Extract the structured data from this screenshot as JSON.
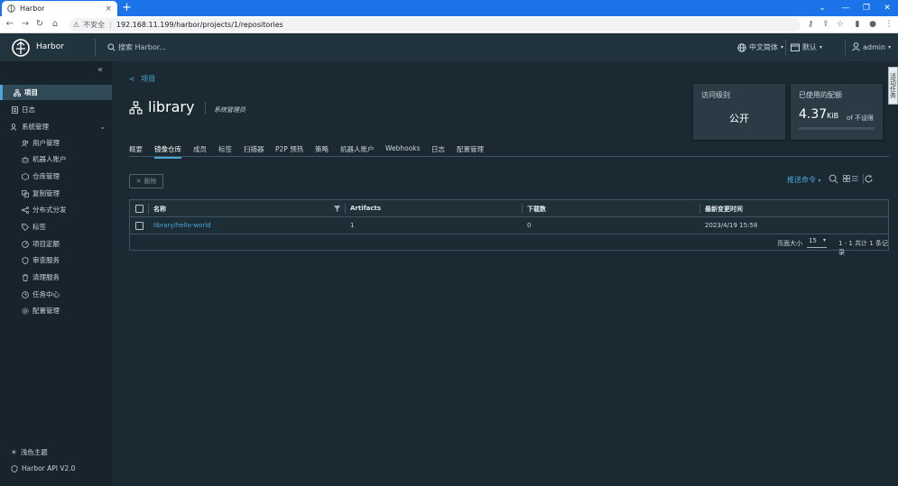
{
  "browser": {
    "tab_title": "Harbor",
    "tab_close": "×",
    "new_tab": "+",
    "insecure_label": "不安全",
    "address": "192.168.11.199/harbor/projects/1/repositories"
  },
  "header": {
    "brand": "Harbor",
    "search_placeholder": "搜索 Harbor...",
    "language": "中文简体",
    "datetime_format": "默认",
    "user": "admin"
  },
  "sidebar": {
    "items": [
      {
        "label": "项目"
      },
      {
        "label": "日志"
      },
      {
        "label": "系统管理"
      },
      {
        "label": "用户管理"
      },
      {
        "label": "机器人账户"
      },
      {
        "label": "仓库管理"
      },
      {
        "label": "复制管理"
      },
      {
        "label": "分布式分发"
      },
      {
        "label": "标签"
      },
      {
        "label": "项目定额"
      },
      {
        "label": "审查服务"
      },
      {
        "label": "清理服务"
      },
      {
        "label": "任务中心"
      },
      {
        "label": "配置管理"
      }
    ],
    "theme_label": "浅色主题",
    "api_label": "Harbor API V2.0"
  },
  "project": {
    "back_label": "项目",
    "name": "library",
    "role": "系统管理员",
    "access_level_title": "访问级别",
    "access_level_value": "公开",
    "quota_title": "已使用的配额",
    "quota_used": "4.37",
    "quota_unit": "KiB",
    "quota_of": "of 不设限",
    "quota_fraction": 0
  },
  "tabs": [
    "概要",
    "镜像仓库",
    "成员",
    "标签",
    "扫描器",
    "P2P 预热",
    "策略",
    "机器人账户",
    "Webhooks",
    "日志",
    "配置管理"
  ],
  "toolbar": {
    "delete_label": "删除",
    "push_command": "推送命令"
  },
  "table": {
    "headers": [
      "名称",
      "Artifacts",
      "下载数",
      "最新变更时间"
    ],
    "rows": [
      {
        "name": "library/hello-world",
        "artifacts": "1",
        "pulls": "0",
        "update_time": "2023/4/19 15:58"
      }
    ],
    "page_size_label": "页面大小",
    "page_size": "15",
    "pagination": "1 - 1 共计 1 条记录"
  },
  "side_panel_label": "活动任务"
}
